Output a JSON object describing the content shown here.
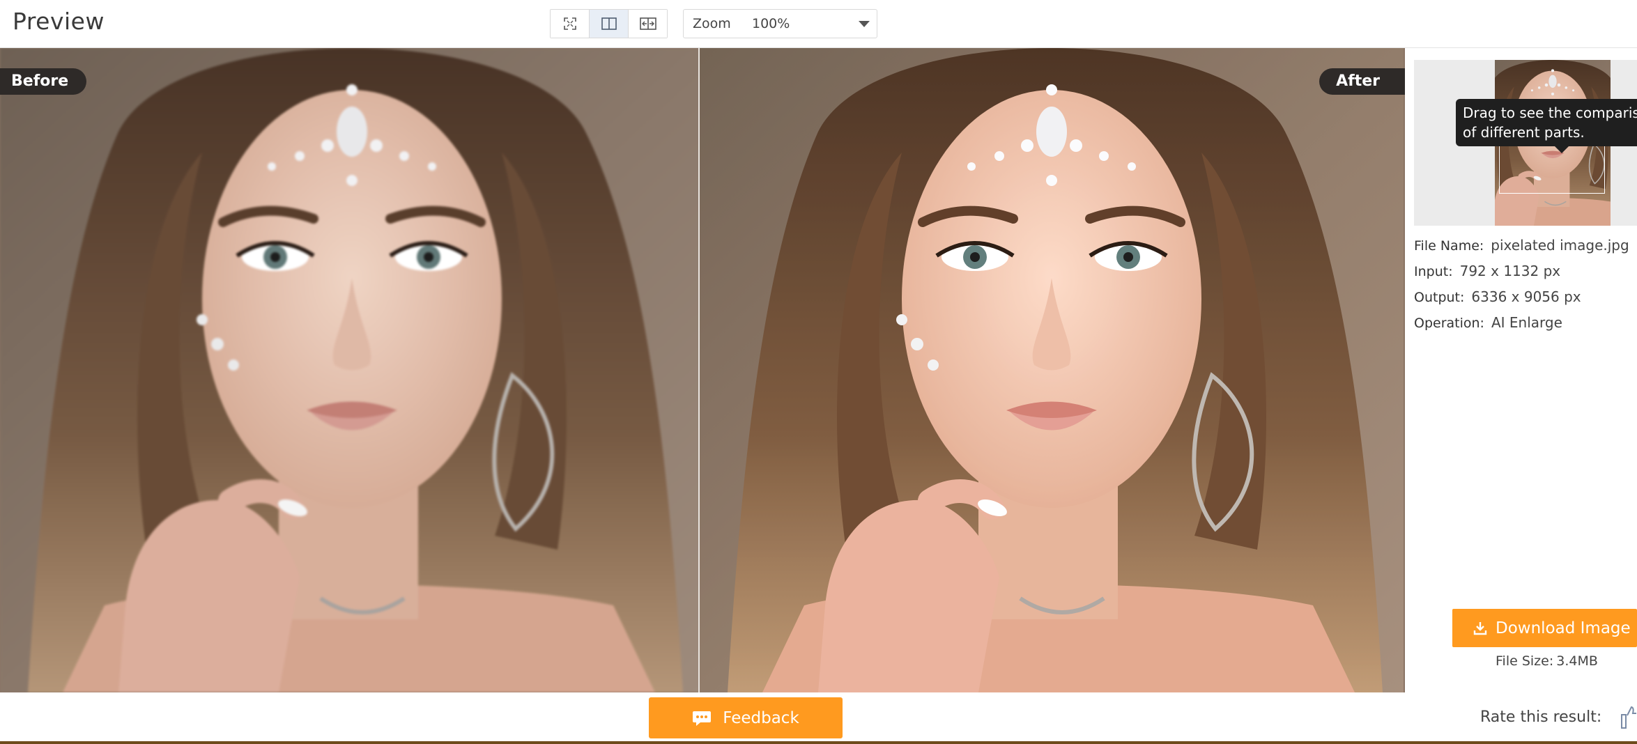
{
  "header": {
    "title": "Preview",
    "view_modes": [
      {
        "name": "fullscreen",
        "icon": "expand-icon"
      },
      {
        "name": "side-by-side",
        "icon": "split-view-icon",
        "active": true
      },
      {
        "name": "slider",
        "icon": "compare-slider-icon"
      }
    ],
    "zoom": {
      "label": "Zoom",
      "value": "100%"
    }
  },
  "compare": {
    "before_label": "Before",
    "after_label": "After"
  },
  "side_panel": {
    "tooltip": {
      "line1": "Drag to see the comparison",
      "line2": "of different parts."
    },
    "info": [
      {
        "key": "File Name:",
        "value": "pixelated image.jpg"
      },
      {
        "key": "Input:",
        "value": "792 x 1132 px"
      },
      {
        "key": "Output:",
        "value": "6336 x 9056 px"
      },
      {
        "key": "Operation:",
        "value": "AI Enlarge"
      }
    ],
    "download_label": "Download Image",
    "file_size_label": "File Size:",
    "file_size_value": "3.4MB"
  },
  "footer": {
    "feedback_label": "Feedback",
    "rate_label": "Rate this result:"
  },
  "colors": {
    "accent": "#ff9a1f",
    "tag_bg": "#2e2a28",
    "active_view_bg": "#e8eef6"
  }
}
